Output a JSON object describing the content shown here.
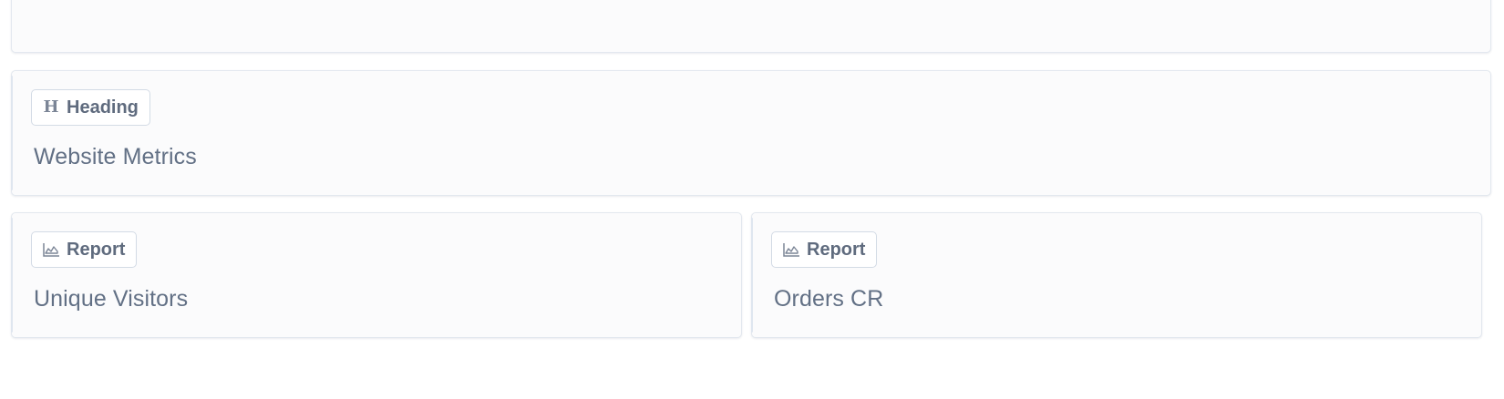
{
  "dashboard": {
    "cards": [
      {
        "badge_label": "Heading",
        "badge_icon": "heading-icon",
        "title": "Website Metrics"
      },
      {
        "badge_label": "Report",
        "badge_icon": "line-chart-icon",
        "title": "Unique Visitors"
      },
      {
        "badge_label": "Report",
        "badge_icon": "line-chart-icon",
        "title": "Orders CR"
      }
    ]
  },
  "colors": {
    "card_background": "#fbfbfc",
    "card_border": "#e3e8ef",
    "text": "#627085",
    "badge_text": "#5f6b7e"
  }
}
